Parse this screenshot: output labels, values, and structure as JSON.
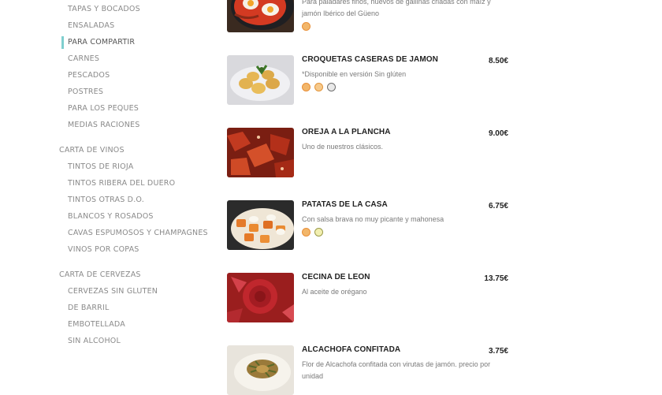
{
  "sidebar": {
    "items": [
      {
        "label": "TAPAS Y BOCADOS",
        "active": false
      },
      {
        "label": "ENSALADAS",
        "active": false
      },
      {
        "label": "PARA COMPARTIR",
        "active": true
      },
      {
        "label": "CARNES",
        "active": false
      },
      {
        "label": "PESCADOS",
        "active": false
      },
      {
        "label": "POSTRES",
        "active": false
      },
      {
        "label": "PARA LOS PEQUES",
        "active": false
      },
      {
        "label": "MEDIAS RACIONES",
        "active": false
      }
    ],
    "wines": {
      "title": "CARTA DE VINOS",
      "items": [
        "TINTOS DE RIOJA",
        "TINTOS RIBERA DEL DUERO",
        "TINTOS OTRAS D.O.",
        "BLANCOS Y ROSADOS",
        "CAVAS ESPUMOSOS Y CHAMPAGNES",
        "VINOS POR COPAS"
      ]
    },
    "beers": {
      "title": "CARTA DE CERVEZAS",
      "items": [
        "CERVEZAS SIN GLUTEN",
        "DE BARRIL",
        "EMBOTELLADA",
        "SIN ALCOHOL"
      ]
    }
  },
  "dishes": [
    {
      "title": "",
      "price": "",
      "description": "Para paladares finos, huevos de gallinas criadas con maíz y jamón Ibérico del Güeno",
      "allergens": [
        "egg-allergen-icon"
      ],
      "image": "fried-eggs-pan-image"
    },
    {
      "title": "CROQUETAS CASERAS DE JAMON",
      "price": "8.50€",
      "description": "*Disponible en versión Sin glúten",
      "allergens": [
        "egg-allergen-icon",
        "gluten-allergen-icon",
        "milk-allergen-icon"
      ],
      "image": "croquetas-image"
    },
    {
      "title": "OREJA A LA PLANCHA",
      "price": "9.00€",
      "description": "Uno de nuestros clásicos.",
      "allergens": [],
      "image": "oreja-image"
    },
    {
      "title": "PATATAS DE LA CASA",
      "price": "6.75€",
      "description": "Con salsa brava no muy picante y mahonesa",
      "allergens": [
        "egg-allergen-icon",
        "mustard-allergen-icon"
      ],
      "image": "patatas-image"
    },
    {
      "title": "CECINA DE LEON",
      "price": "13.75€",
      "description": "Al aceite de orégano",
      "allergens": [],
      "image": "cecina-image"
    },
    {
      "title": "ALCACHOFA CONFITADA",
      "price": "3.75€",
      "description": "Flor de Alcachofa confitada con virutas de jamón. precio por unidad",
      "allergens": [],
      "image": "alcachofa-image"
    }
  ],
  "colors": {
    "accent": "#7fcfcf",
    "text": "#222222",
    "muted": "#8a8a8a"
  }
}
